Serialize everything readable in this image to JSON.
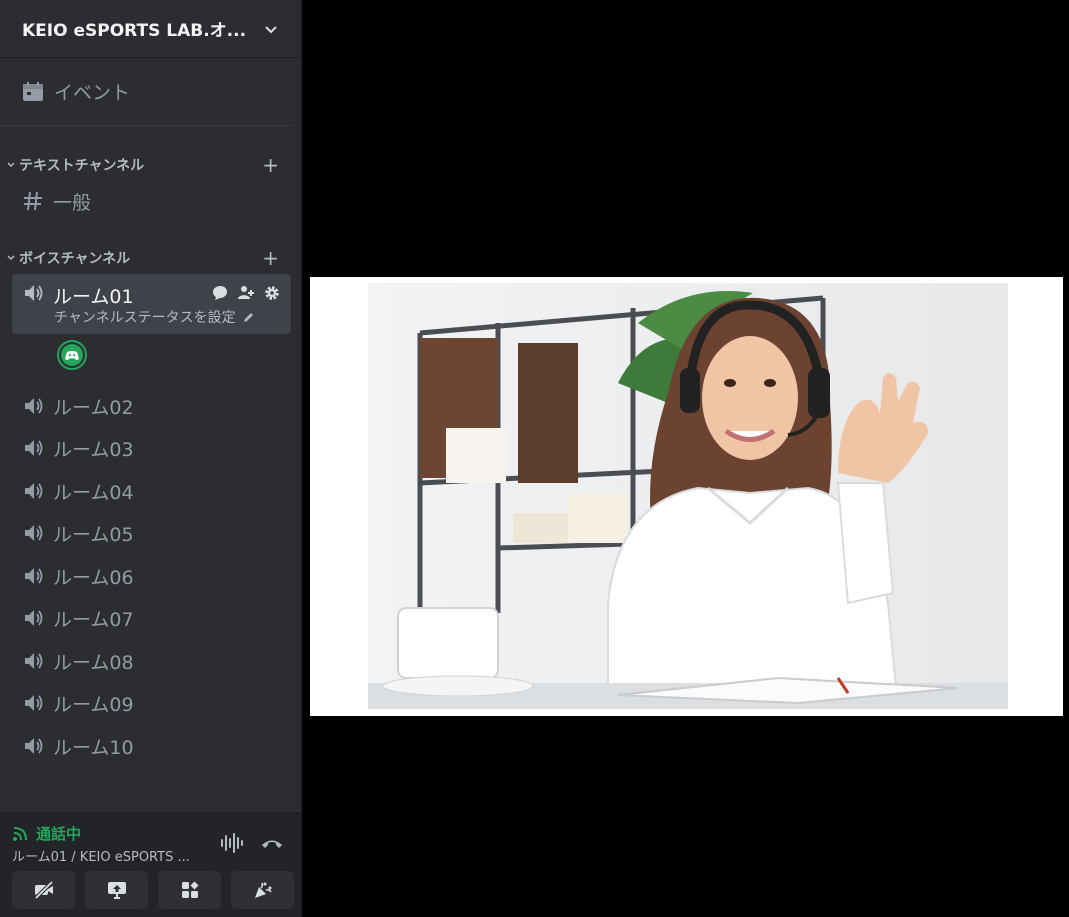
{
  "server": {
    "name": "KEIO eSPORTS LAB.オ..."
  },
  "events": {
    "label": "イベント"
  },
  "text_category": {
    "label": "テキストチャンネル"
  },
  "text_channels": [
    {
      "name": "一般"
    }
  ],
  "voice_category": {
    "label": "ボイスチャンネル"
  },
  "voice_channels": [
    {
      "name": "ルーム01",
      "status_placeholder": "チャンネルステータスを設定"
    },
    {
      "name": "ルーム02"
    },
    {
      "name": "ルーム03"
    },
    {
      "name": "ルーム04"
    },
    {
      "name": "ルーム05"
    },
    {
      "name": "ルーム06"
    },
    {
      "name": "ルーム07"
    },
    {
      "name": "ルーム08"
    },
    {
      "name": "ルーム09"
    },
    {
      "name": "ルーム10"
    }
  ],
  "voice_panel": {
    "status": "通話中",
    "location": "ルーム01 / KEIO eSPORTS ..."
  },
  "colors": {
    "sidebar_bg": "#2b2d31",
    "connected_green": "#23a55a",
    "text_muted": "#949ba4",
    "active_bg": "#404249"
  }
}
